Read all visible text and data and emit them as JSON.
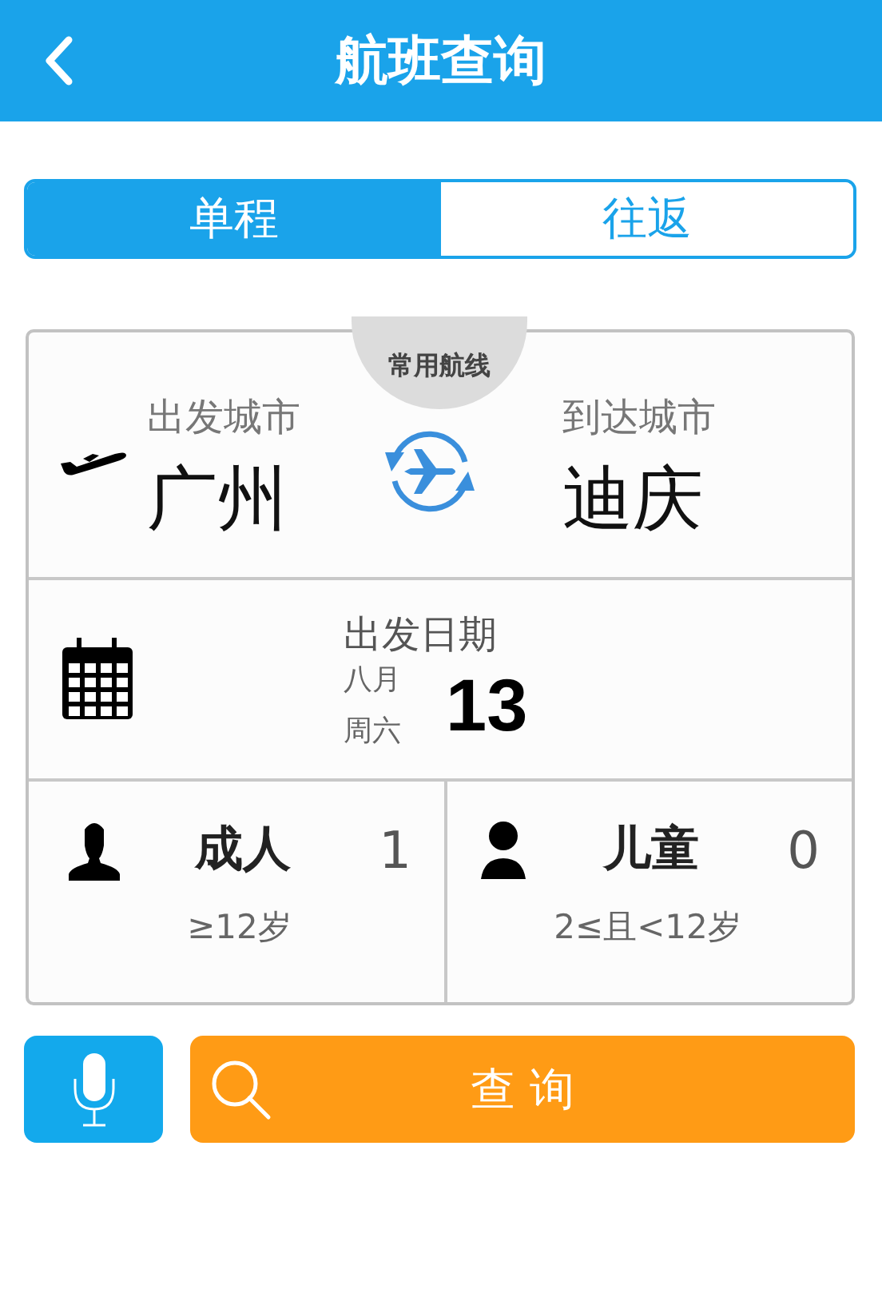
{
  "header": {
    "title": "航班查询"
  },
  "tabs": [
    {
      "label": "单程",
      "selected": true
    },
    {
      "label": "往返",
      "selected": false
    }
  ],
  "route": {
    "badge": "常用航线",
    "from": {
      "label": "出发城市",
      "city": "广州"
    },
    "to": {
      "label": "到达城市",
      "city": "迪庆"
    }
  },
  "date": {
    "label": "出发日期",
    "month": "八月",
    "weekday": "周六",
    "day": "13"
  },
  "passengers": [
    {
      "kind": "adult",
      "name": "成人",
      "count": "1",
      "range": "≥12岁"
    },
    {
      "kind": "child",
      "name": "儿童",
      "count": "0",
      "range": "2≤且<12岁"
    }
  ],
  "search_button": {
    "label": "查 询"
  }
}
